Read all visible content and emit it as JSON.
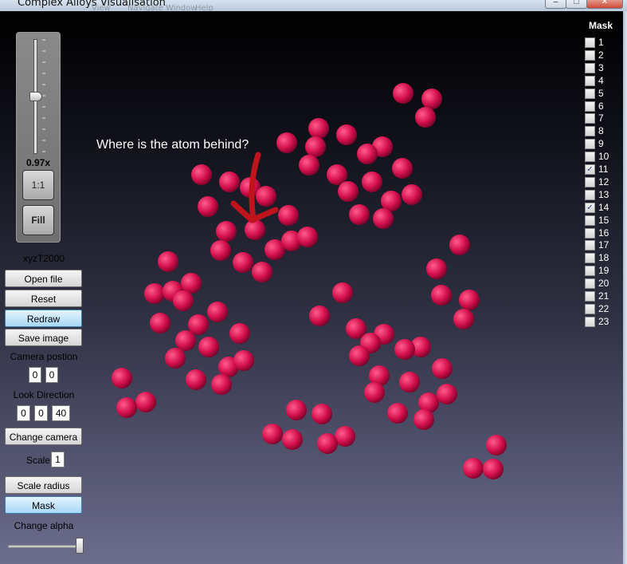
{
  "window": {
    "title": "Complex Alloys Visualisation",
    "menu_ghost": [
      "View",
      "Navigate",
      "Window",
      "Help"
    ]
  },
  "zoom": {
    "value_label": "0.97x",
    "one_to_one_label": "1:1",
    "fill_label": "Fill"
  },
  "file": {
    "name": "xyzT2000"
  },
  "buttons": {
    "open_file": "Open file",
    "reset": "Reset",
    "redraw": "Redraw",
    "save_image": "Save image",
    "change_camera": "Change camera",
    "scale_radius": "Scale radius",
    "mask": "Mask"
  },
  "camera": {
    "position_label": "Camera postion",
    "position": [
      "0",
      "0"
    ],
    "look_label": "Look Direction",
    "look": [
      "0",
      "0",
      "40"
    ]
  },
  "scale": {
    "label": "Scale",
    "value": "1"
  },
  "alpha": {
    "label": "Change alpha"
  },
  "mask": {
    "title": "Mask",
    "items": [
      {
        "label": "1",
        "checked": false
      },
      {
        "label": "2",
        "checked": false
      },
      {
        "label": "3",
        "checked": false
      },
      {
        "label": "4",
        "checked": false
      },
      {
        "label": "5",
        "checked": false
      },
      {
        "label": "6",
        "checked": false
      },
      {
        "label": "7",
        "checked": false
      },
      {
        "label": "8",
        "checked": false
      },
      {
        "label": "9",
        "checked": false
      },
      {
        "label": "10",
        "checked": false
      },
      {
        "label": "11",
        "checked": true
      },
      {
        "label": "12",
        "checked": false
      },
      {
        "label": "13",
        "checked": false
      },
      {
        "label": "14",
        "checked": true
      },
      {
        "label": "15",
        "checked": false
      },
      {
        "label": "16",
        "checked": false
      },
      {
        "label": "17",
        "checked": false
      },
      {
        "label": "18",
        "checked": false
      },
      {
        "label": "19",
        "checked": false
      },
      {
        "label": "20",
        "checked": false
      },
      {
        "label": "21",
        "checked": false
      },
      {
        "label": "22",
        "checked": false
      },
      {
        "label": "23",
        "checked": false
      }
    ]
  },
  "annotation": {
    "text": "Where is the atom behind?"
  },
  "colors": {
    "atom": "#d4104e",
    "atom_highlight": "#ff5c8c",
    "atom_shadow": "#6a0022",
    "arrow": "#c0141c"
  }
}
